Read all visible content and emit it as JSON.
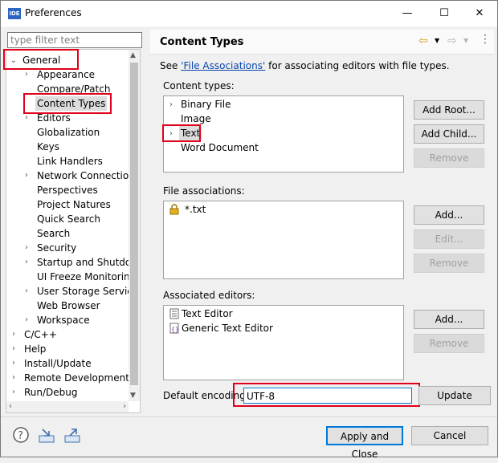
{
  "window": {
    "title": "Preferences",
    "app_icon": "IDE"
  },
  "filter": {
    "placeholder": "type filter text"
  },
  "tree": {
    "general": "General",
    "general_children": [
      "Appearance",
      "Compare/Patch",
      "Content Types",
      "Editors",
      "Globalization",
      "Keys",
      "Link Handlers",
      "Network Connection",
      "Perspectives",
      "Project Natures",
      "Quick Search",
      "Search",
      "Security",
      "Startup and Shutdow",
      "UI Freeze Monitoring",
      "User Storage Service",
      "Web Browser",
      "Workspace"
    ],
    "top_level": [
      "C/C++",
      "Help",
      "Install/Update",
      "Remote Development",
      "Run/Debug"
    ]
  },
  "page": {
    "title": "Content Types",
    "see_prefix": "See ",
    "see_link": "'File Associations'",
    "see_suffix": " for associating editors with file types.",
    "content_types_label": "Content types:",
    "content_types": [
      "Binary File",
      "Image",
      "Text",
      "Word Document"
    ],
    "file_assoc_label": "File associations:",
    "file_assoc": [
      "*.txt"
    ],
    "assoc_editors_label": "Associated editors:",
    "assoc_editors": [
      "Text Editor",
      "Generic Text Editor"
    ],
    "encoding_label": "Default encoding:",
    "encoding_value": "UTF-8"
  },
  "buttons": {
    "add_root": "Add Root...",
    "add_child": "Add Child...",
    "remove": "Remove",
    "add": "Add...",
    "edit": "Edit...",
    "update": "Update",
    "apply_close": "Apply and Close",
    "cancel": "Cancel"
  }
}
